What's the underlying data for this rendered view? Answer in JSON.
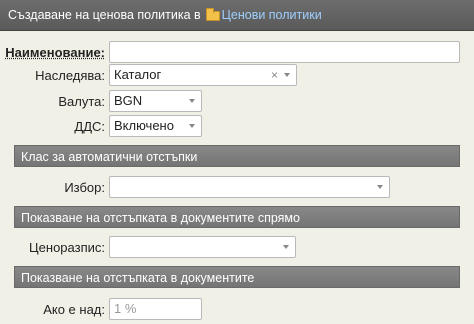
{
  "title": {
    "prefix": "Създаване на ценова политика в",
    "folder_link": "Ценови политики"
  },
  "form": {
    "name_label": "Наименование:",
    "name_value": "",
    "inherits_label": "Наследява:",
    "inherits_value": "Каталог",
    "inherits_clear": "×",
    "currency_label": "Валута:",
    "currency_value": "BGN",
    "vat_label": "ДДС:",
    "vat_value": "Включено"
  },
  "sections": {
    "auto_discounts": "Клас за автоматични отстъпки",
    "discount_display_relative": "Показване на отстъпката в документите спрямо",
    "discount_display": "Показване на отстъпката в документите"
  },
  "auto_discounts": {
    "choice_label": "Избор:",
    "choice_value": ""
  },
  "relative": {
    "pricelist_label": "Ценоразпис:",
    "pricelist_value": ""
  },
  "display": {
    "if_above_label": "Ако е над:",
    "if_above_placeholder": "1 %"
  }
}
